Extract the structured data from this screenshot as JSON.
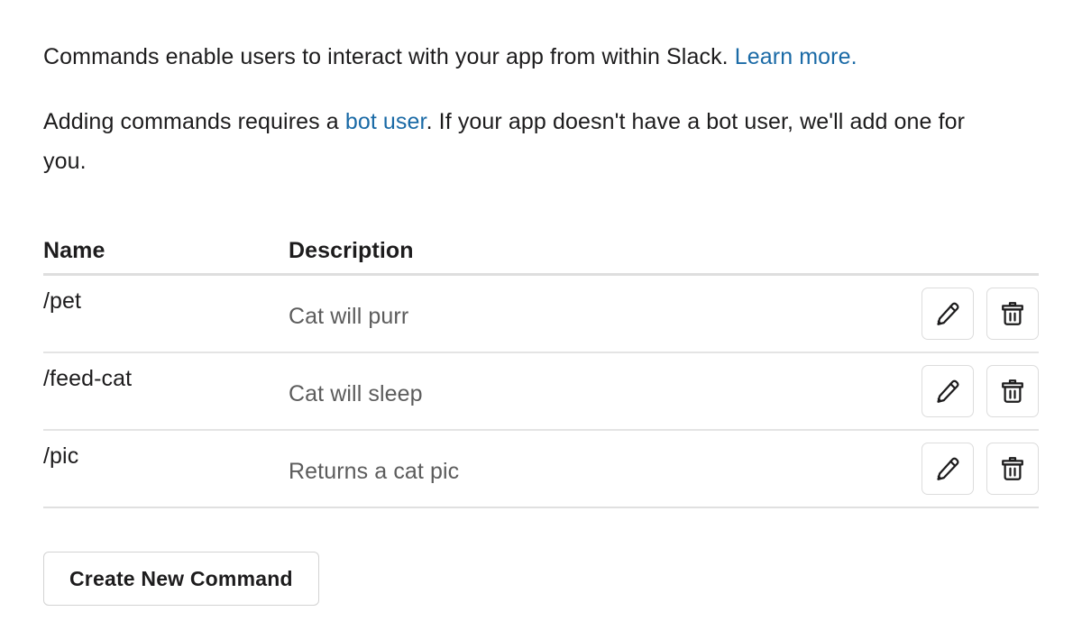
{
  "intro": {
    "paragraph1_before": "Commands enable users to interact with your app from within Slack.",
    "learn_more_label": "Learn more.",
    "paragraph2_part1": "Adding commands requires a",
    "bot_user_label": "bot user",
    "paragraph2_part2": ". If your app doesn't have a bot user, we'll add one for you."
  },
  "table": {
    "headers": {
      "name": "Name",
      "description": "Description"
    },
    "rows": [
      {
        "name": "/pet",
        "description": "Cat will purr",
        "edit_icon": "pencil-icon",
        "delete_icon": "trash-icon"
      },
      {
        "name": "/feed-cat",
        "description": "Cat will sleep",
        "edit_icon": "pencil-icon",
        "delete_icon": "trash-icon"
      },
      {
        "name": "/pic",
        "description": "Returns a cat pic",
        "edit_icon": "pencil-icon",
        "delete_icon": "trash-icon"
      }
    ]
  },
  "footer": {
    "create_button_label": "Create New Command"
  },
  "colors": {
    "text": "#1d1c1d",
    "muted_text": "#5c5c5c",
    "link": "#1a6aa6",
    "rule": "#dedede",
    "row_rule": "#e4e4e4",
    "button_border": "#d3d3d3",
    "background": "#ffffff"
  }
}
